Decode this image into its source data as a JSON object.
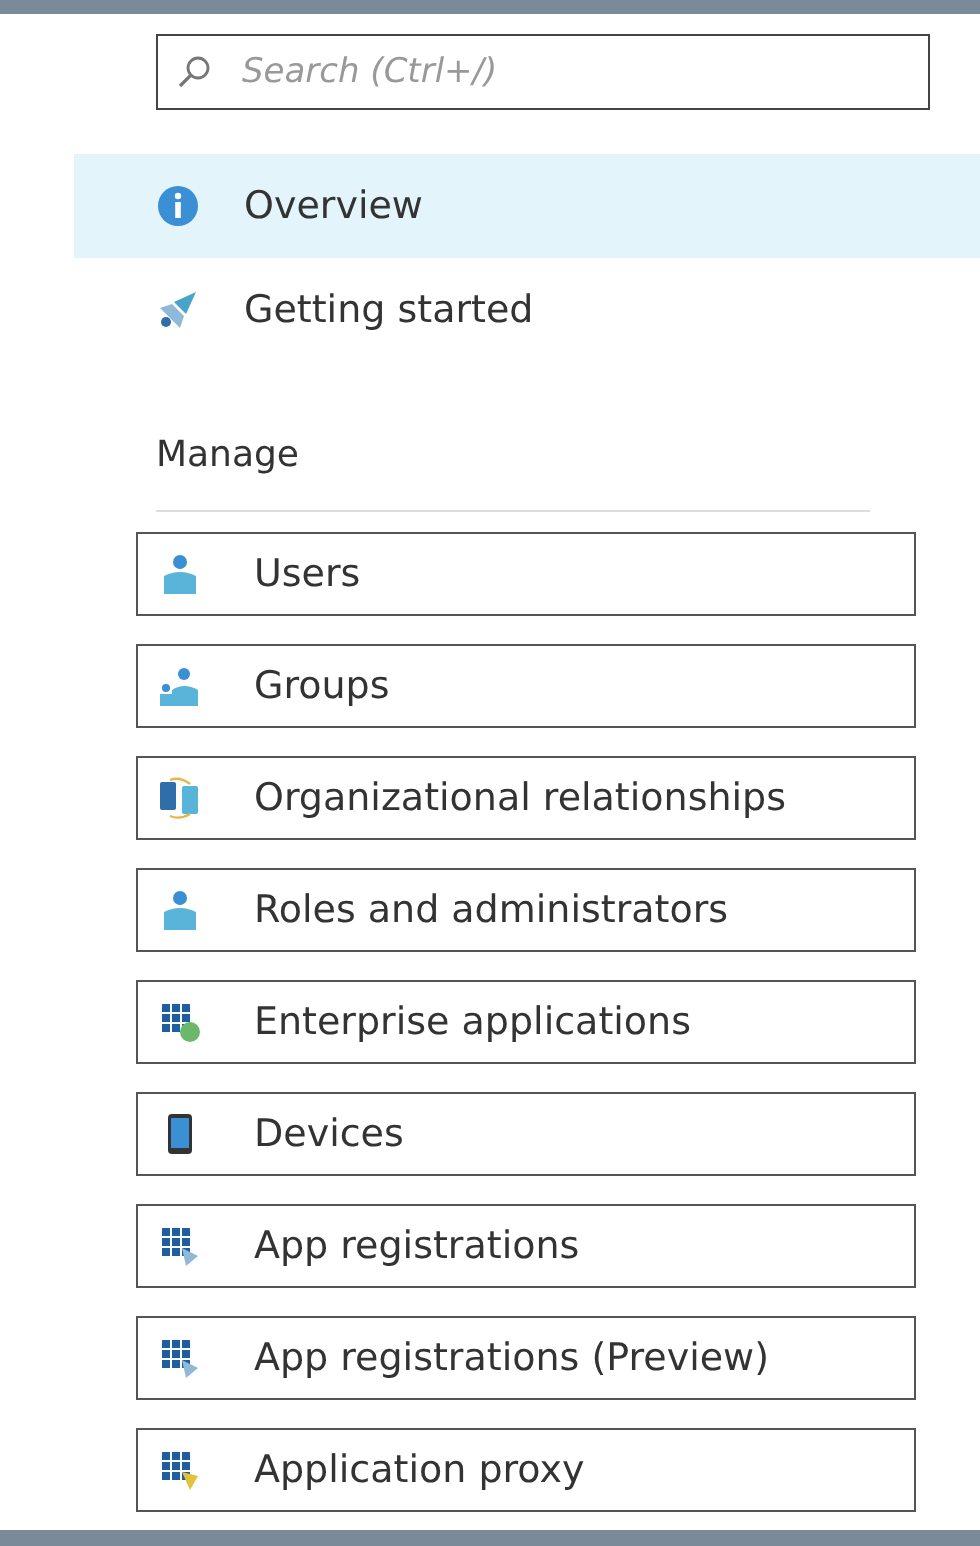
{
  "search": {
    "placeholder": "Search (Ctrl+/)"
  },
  "nav": [
    {
      "label": "Overview",
      "kind": "info",
      "selected": true
    },
    {
      "label": "Getting started",
      "kind": "rocket",
      "selected": false
    }
  ],
  "manage": {
    "heading": "Manage",
    "items": [
      {
        "label": "Users",
        "kind": "person",
        "selected": false
      },
      {
        "label": "Groups",
        "kind": "people",
        "selected": false
      },
      {
        "label": "Organizational relationships",
        "kind": "devices",
        "selected": false
      },
      {
        "label": "Roles and administrators",
        "kind": "person",
        "selected": false
      },
      {
        "label": "Enterprise applications",
        "kind": "globe",
        "selected": false
      },
      {
        "label": "Devices",
        "kind": "phone",
        "selected": false
      },
      {
        "label": "App registrations",
        "kind": "grid",
        "selected": false
      },
      {
        "label": "App registrations (Preview)",
        "kind": "grid",
        "selected": false
      },
      {
        "label": "Application proxy",
        "kind": "proxy",
        "selected": false
      }
    ]
  }
}
